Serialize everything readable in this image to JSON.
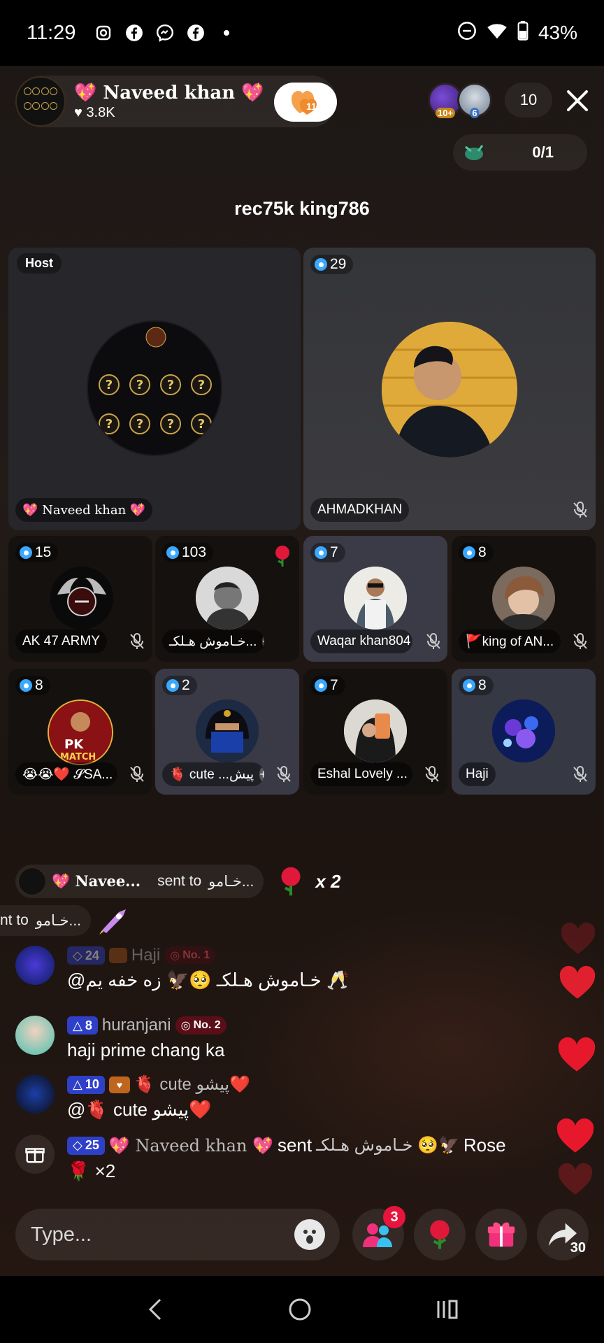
{
  "status_bar": {
    "time": "11:29",
    "battery": "43%",
    "icons": [
      "instagram-icon",
      "facebook-icon",
      "messenger-icon",
      "facebook-icon",
      "dot-icon"
    ],
    "right_icons": [
      "dnd-icon",
      "wifi-icon",
      "battery-icon"
    ]
  },
  "header": {
    "host_name": "💖 Naveed khan 💖",
    "host_likes": "3.8K",
    "follow_badge": "11",
    "viewer_badges": [
      "10+",
      "6"
    ],
    "viewer_count": "10",
    "seat_count": "0/1"
  },
  "room_title": "rec75k king786",
  "tiles": {
    "host": {
      "label": "Host",
      "name": "💖 Naveed khan 💖"
    },
    "ahmad": {
      "level": "29",
      "name": "AHMADKHAN"
    },
    "ak47": {
      "level": "15",
      "name": "AK 47 ARMY"
    },
    "khamosh": {
      "level": "103",
      "name": "خـاموش هـلکـ..."
    },
    "waqar": {
      "level": "7",
      "name": "Waqar khan804"
    },
    "kingof": {
      "level": "8",
      "name": "🚩king of AN..."
    },
    "pk": {
      "level": "8",
      "name": "😭😭❤️ 𝓢SA..."
    },
    "cute": {
      "level": "2",
      "name": "🫀 cute ...پیش"
    },
    "eshal": {
      "level": "7",
      "name": "Eshal Lovely ..."
    },
    "haji": {
      "level": "8",
      "name": "Haji"
    }
  },
  "gift_banner": {
    "sender": "💖 Navee...",
    "text": "sent to",
    "target": "خـامو...",
    "multiplier": "x 2"
  },
  "gift_banner_2": {
    "text": "nt to",
    "target": "خـامو..."
  },
  "messages": [
    {
      "level": "24",
      "name": "Haji",
      "medal": "No. 1",
      "text": "@خـاموش هـلکـ 🥺🦅 زه خفه يم 🥂"
    },
    {
      "level": "8",
      "name": "huranjani",
      "medal": "No. 2",
      "text": "haji prime chang ka"
    },
    {
      "level": "10",
      "name": "🫀 cute پیشو❤️",
      "text": "@🫀 cute پیشو❤️"
    },
    {
      "level": "25",
      "text_sender": "💖 Naveed khan 💖",
      "text_verb": "sent",
      "text_target": "خـاموش هـلکـ 🥺🦅",
      "gift_name": "Rose",
      "gift_count": "×2"
    }
  ],
  "input": {
    "placeholder": "Type..."
  },
  "actions": {
    "share_count": "30",
    "friends_badge": "3"
  },
  "colors": {
    "accent_blue": "#2f40c8",
    "red": "#e7153d",
    "medal_red": "#ff5a6a"
  }
}
